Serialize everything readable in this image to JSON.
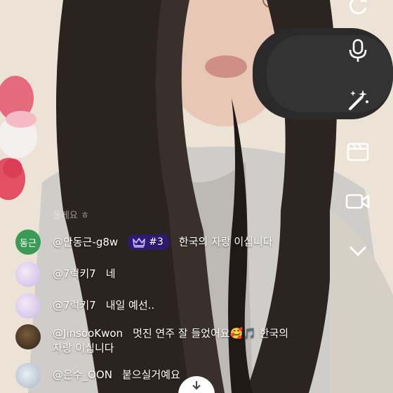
{
  "chat": {
    "faded_line": "을게요 ㅎ",
    "messages": [
      {
        "user": "@안동근-g8w",
        "avatar_text": "동근",
        "avatar_color": "#3c9a57",
        "badge": "#3",
        "text": "한국의 자랑 이십니다"
      },
      {
        "user": "@7럭키7",
        "text": "네"
      },
      {
        "user": "@7럭키7",
        "text": "내일 예선.."
      },
      {
        "user": "@JinsooKwon",
        "text": "멋진 연주 잘 들었어요🥰🎵 한국의",
        "text2": "자랑 이십니다"
      },
      {
        "user": "@은수_OON",
        "text": "붙으실거예요"
      }
    ]
  },
  "rail": {
    "icons": [
      "refresh-icon",
      "microphone-icon",
      "magic-wand-icon",
      "clapperboard-icon",
      "video-camera-icon",
      "chevron-down-icon"
    ]
  },
  "colors": {
    "badge_bg": "#2e1a70",
    "crown": "#c7b5ff"
  }
}
